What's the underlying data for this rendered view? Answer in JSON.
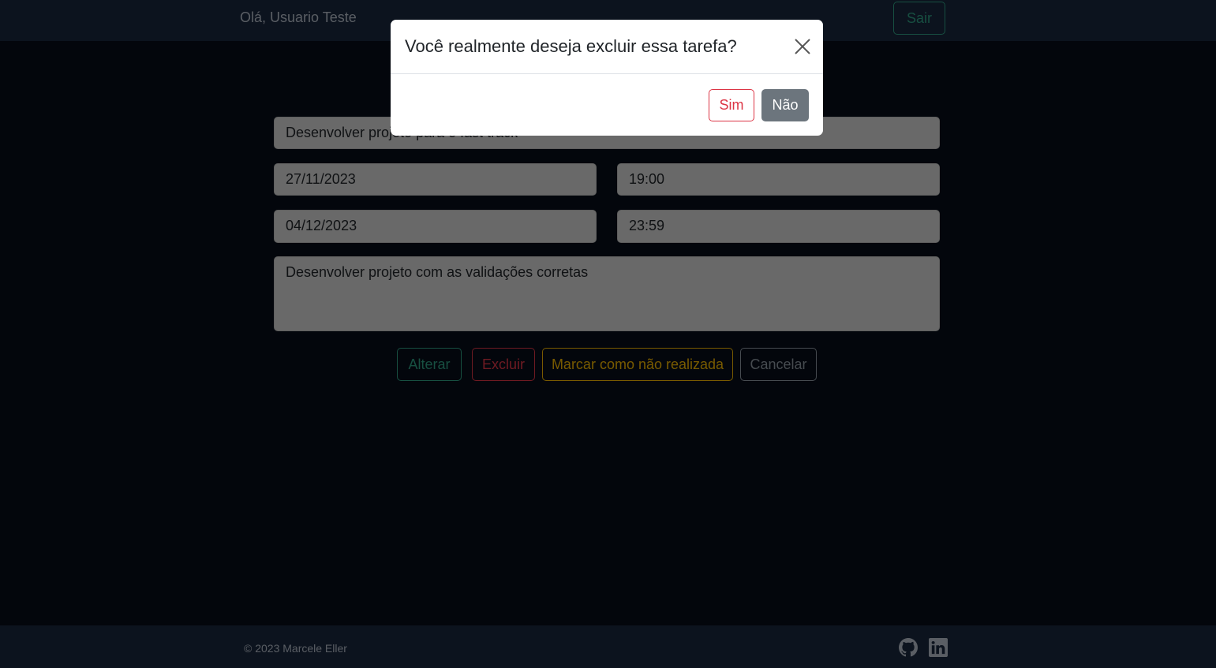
{
  "header": {
    "greeting": "Olá, Usuario Teste",
    "logout_label": "Sair"
  },
  "form": {
    "title": "Desenvolver projeto para o fast track",
    "start_date": "27/11/2023",
    "start_time": "19:00",
    "end_date": "04/12/2023",
    "end_time": "23:59",
    "description": "Desenvolver projeto com as validações corretas"
  },
  "actions": {
    "alter_label": "Alterar",
    "delete_label": "Excluir",
    "mark_label": "Marcar como não realizada",
    "cancel_label": "Cancelar"
  },
  "modal": {
    "title": "Você realmente deseja excluir essa tarefa?",
    "yes_label": "Sim",
    "no_label": "Não",
    "close_icon": "close-icon"
  },
  "footer": {
    "copyright": "© 2023 Marcele Eller",
    "social": [
      "github-icon",
      "linkedin-icon"
    ]
  },
  "colors": {
    "accent": "#2f9e83",
    "danger": "#dc3545",
    "warning": "#f0b400",
    "secondary": "#6c757d",
    "navbar": "#18263c",
    "background": "#060d18"
  }
}
